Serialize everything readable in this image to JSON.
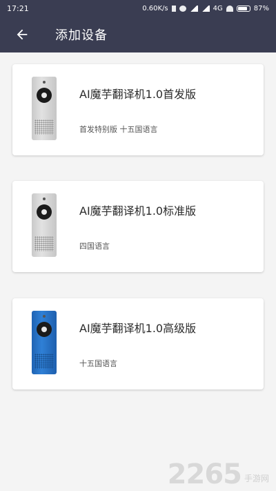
{
  "status_bar": {
    "time": "17:21",
    "network_speed": "0.60K/s",
    "network_type": "4G",
    "battery": "87%",
    "icons": [
      "bluetooth-icon",
      "alarm-icon",
      "signal-icon",
      "signal-icon",
      "wifi-icon",
      "battery-icon"
    ]
  },
  "header": {
    "title": "添加设备",
    "back_icon": "back-arrow-icon",
    "background": "#3a3d52"
  },
  "devices": [
    {
      "name": "AI魔芋翻译机1.0首发版",
      "description": "首发特别版 十五国语言",
      "color": "silver"
    },
    {
      "name": "AI魔芋翻译机1.0标准版",
      "description": "四国语言",
      "color": "silver"
    },
    {
      "name": "AI魔芋翻译机1.0高级版",
      "description": "十五国语言",
      "color": "blue"
    }
  ],
  "watermark": {
    "number": "2265",
    "suffix": "手游网"
  }
}
